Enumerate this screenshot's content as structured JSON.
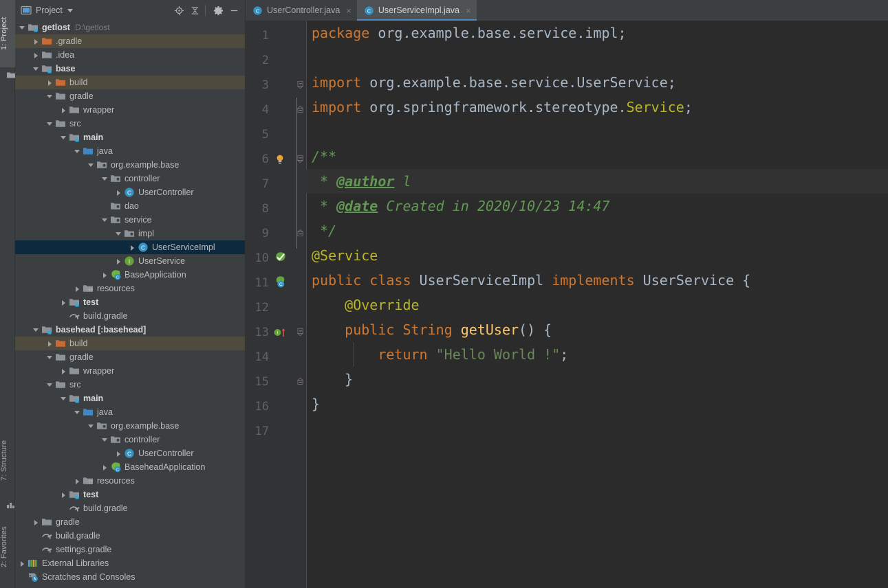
{
  "window": {
    "theme_bg": "#3c3f41",
    "editor_bg": "#2b2b2b",
    "accent": "#4a88c7",
    "selection": "#0d293e",
    "excluded_bg": "#4e4a3e"
  },
  "rail": {
    "items": [
      {
        "label": "1: Project",
        "icon": "project-icon",
        "active": true
      },
      {
        "label": "7: Structure",
        "icon": "structure-icon",
        "active": false
      },
      {
        "label": "2: Favorites",
        "icon": "favorites-icon",
        "active": false
      }
    ]
  },
  "project_panel": {
    "header": {
      "icon": "project-window-icon",
      "title": "Project",
      "caret": "chevron-down-icon",
      "buttons": [
        {
          "name": "locate-icon",
          "title": "Select Opened File"
        },
        {
          "name": "collapse-all-icon",
          "title": "Collapse All"
        },
        {
          "name": "gear-icon",
          "title": "Settings"
        },
        {
          "name": "minimize-icon",
          "title": "Hide"
        }
      ]
    },
    "tree": [
      {
        "indent": 0,
        "arrow": "down",
        "icon": "module-root-icon",
        "label": "getlost",
        "bold": true,
        "sub": "D:\\getlost",
        "state": "normal"
      },
      {
        "indent": 1,
        "arrow": "right",
        "icon": "folder-excluded-icon",
        "label": ".gradle",
        "bold": false,
        "sub": "",
        "state": "excluded"
      },
      {
        "indent": 1,
        "arrow": "right",
        "icon": "folder-icon",
        "label": ".idea",
        "bold": false,
        "sub": "",
        "state": "normal"
      },
      {
        "indent": 1,
        "arrow": "down",
        "icon": "module-root-icon",
        "label": "base",
        "bold": true,
        "sub": "",
        "state": "normal"
      },
      {
        "indent": 2,
        "arrow": "right",
        "icon": "folder-excluded-icon",
        "label": "build",
        "bold": false,
        "sub": "",
        "state": "excluded"
      },
      {
        "indent": 2,
        "arrow": "down",
        "icon": "folder-icon",
        "label": "gradle",
        "bold": false,
        "sub": "",
        "state": "normal"
      },
      {
        "indent": 3,
        "arrow": "right",
        "icon": "folder-icon",
        "label": "wrapper",
        "bold": false,
        "sub": "",
        "state": "normal"
      },
      {
        "indent": 2,
        "arrow": "down",
        "icon": "folder-icon",
        "label": "src",
        "bold": false,
        "sub": "",
        "state": "normal"
      },
      {
        "indent": 3,
        "arrow": "down",
        "icon": "module-root-icon",
        "label": "main",
        "bold": true,
        "sub": "",
        "state": "normal"
      },
      {
        "indent": 4,
        "arrow": "down",
        "icon": "source-root-icon",
        "label": "java",
        "bold": false,
        "sub": "",
        "state": "normal"
      },
      {
        "indent": 5,
        "arrow": "down",
        "icon": "package-icon",
        "label": "org.example.base",
        "bold": false,
        "sub": "",
        "state": "normal"
      },
      {
        "indent": 6,
        "arrow": "down",
        "icon": "package-icon",
        "label": "controller",
        "bold": false,
        "sub": "",
        "state": "normal"
      },
      {
        "indent": 7,
        "arrow": "right",
        "icon": "class-icon",
        "label": "UserController",
        "bold": false,
        "sub": "",
        "state": "normal"
      },
      {
        "indent": 6,
        "arrow": "none",
        "icon": "package-icon",
        "label": "dao",
        "bold": false,
        "sub": "",
        "state": "normal"
      },
      {
        "indent": 6,
        "arrow": "down",
        "icon": "package-icon",
        "label": "service",
        "bold": false,
        "sub": "",
        "state": "normal"
      },
      {
        "indent": 7,
        "arrow": "down",
        "icon": "package-icon",
        "label": "impl",
        "bold": false,
        "sub": "",
        "state": "normal"
      },
      {
        "indent": 8,
        "arrow": "right",
        "icon": "class-icon",
        "label": "UserServiceImpl",
        "bold": false,
        "sub": "",
        "state": "selected"
      },
      {
        "indent": 7,
        "arrow": "right",
        "icon": "interface-icon",
        "label": "UserService",
        "bold": false,
        "sub": "",
        "state": "normal"
      },
      {
        "indent": 6,
        "arrow": "right",
        "icon": "spring-class-icon",
        "label": "BaseApplication",
        "bold": false,
        "sub": "",
        "state": "normal"
      },
      {
        "indent": 4,
        "arrow": "right",
        "icon": "resources-root-icon",
        "label": "resources",
        "bold": false,
        "sub": "",
        "state": "normal"
      },
      {
        "indent": 3,
        "arrow": "right",
        "icon": "test-root-icon",
        "label": "test",
        "bold": true,
        "sub": "",
        "state": "normal"
      },
      {
        "indent": 3,
        "arrow": "none",
        "icon": "gradle-file-icon",
        "label": "build.gradle",
        "bold": false,
        "sub": "",
        "state": "normal"
      },
      {
        "indent": 1,
        "arrow": "down",
        "icon": "module-root-icon",
        "label": "basehead [:basehead]",
        "bold": true,
        "sub": "",
        "state": "normal"
      },
      {
        "indent": 2,
        "arrow": "right",
        "icon": "folder-excluded-icon",
        "label": "build",
        "bold": false,
        "sub": "",
        "state": "excluded"
      },
      {
        "indent": 2,
        "arrow": "down",
        "icon": "folder-icon",
        "label": "gradle",
        "bold": false,
        "sub": "",
        "state": "normal"
      },
      {
        "indent": 3,
        "arrow": "right",
        "icon": "folder-icon",
        "label": "wrapper",
        "bold": false,
        "sub": "",
        "state": "normal"
      },
      {
        "indent": 2,
        "arrow": "down",
        "icon": "folder-icon",
        "label": "src",
        "bold": false,
        "sub": "",
        "state": "normal"
      },
      {
        "indent": 3,
        "arrow": "down",
        "icon": "module-root-icon",
        "label": "main",
        "bold": true,
        "sub": "",
        "state": "normal"
      },
      {
        "indent": 4,
        "arrow": "down",
        "icon": "source-root-icon",
        "label": "java",
        "bold": false,
        "sub": "",
        "state": "normal"
      },
      {
        "indent": 5,
        "arrow": "down",
        "icon": "package-icon",
        "label": "org.example.base",
        "bold": false,
        "sub": "",
        "state": "normal"
      },
      {
        "indent": 6,
        "arrow": "down",
        "icon": "package-icon",
        "label": "controller",
        "bold": false,
        "sub": "",
        "state": "normal"
      },
      {
        "indent": 7,
        "arrow": "right",
        "icon": "class-icon",
        "label": "UserController",
        "bold": false,
        "sub": "",
        "state": "normal"
      },
      {
        "indent": 6,
        "arrow": "right",
        "icon": "spring-class-icon",
        "label": "BaseheadApplication",
        "bold": false,
        "sub": "",
        "state": "normal"
      },
      {
        "indent": 4,
        "arrow": "right",
        "icon": "resources-root-icon",
        "label": "resources",
        "bold": false,
        "sub": "",
        "state": "normal"
      },
      {
        "indent": 3,
        "arrow": "right",
        "icon": "test-root-icon",
        "label": "test",
        "bold": true,
        "sub": "",
        "state": "normal"
      },
      {
        "indent": 3,
        "arrow": "none",
        "icon": "gradle-file-icon",
        "label": "build.gradle",
        "bold": false,
        "sub": "",
        "state": "normal"
      },
      {
        "indent": 1,
        "arrow": "right",
        "icon": "folder-icon",
        "label": "gradle",
        "bold": false,
        "sub": "",
        "state": "normal"
      },
      {
        "indent": 1,
        "arrow": "none",
        "icon": "gradle-file-icon",
        "label": "build.gradle",
        "bold": false,
        "sub": "",
        "state": "normal"
      },
      {
        "indent": 1,
        "arrow": "none",
        "icon": "gradle-file-icon",
        "label": "settings.gradle",
        "bold": false,
        "sub": "",
        "state": "normal"
      },
      {
        "indent": 0,
        "arrow": "right",
        "icon": "external-libraries-icon",
        "label": "External Libraries",
        "bold": false,
        "sub": "",
        "state": "normal"
      },
      {
        "indent": 0,
        "arrow": "none",
        "icon": "scratches-icon",
        "label": "Scratches and Consoles",
        "bold": false,
        "sub": "",
        "state": "normal"
      }
    ]
  },
  "editor": {
    "tabs": [
      {
        "label": "UserControllerjava",
        "display": "UserController.java",
        "icon": "java-class-icon",
        "active": false,
        "close": "×"
      },
      {
        "label": "UserServiceImpl.java",
        "display": "UserServiceImpl.java",
        "icon": "java-class-icon",
        "active": true,
        "close": "×"
      }
    ],
    "lines": [
      {
        "n": "1",
        "gutter_icon": "",
        "fold": "",
        "current": false,
        "tokens": [
          {
            "t": "package",
            "c": "kw"
          },
          {
            "t": " org.example.base.service.impl;",
            "c": "id"
          }
        ]
      },
      {
        "n": "2",
        "gutter_icon": "",
        "fold": "",
        "current": false,
        "tokens": []
      },
      {
        "n": "3",
        "gutter_icon": "",
        "fold": "top",
        "current": false,
        "tokens": [
          {
            "t": "import",
            "c": "kw"
          },
          {
            "t": " org.example.base.service.UserService;",
            "c": "id"
          }
        ]
      },
      {
        "n": "4",
        "gutter_icon": "",
        "fold": "bottom",
        "current": false,
        "tokens": [
          {
            "t": "import",
            "c": "kw"
          },
          {
            "t": " org.springframework.stereotype.",
            "c": "id"
          },
          {
            "t": "Service",
            "c": "ann"
          },
          {
            "t": ";",
            "c": "id"
          }
        ]
      },
      {
        "n": "5",
        "gutter_icon": "",
        "fold": "",
        "current": false,
        "tokens": []
      },
      {
        "n": "6",
        "gutter_icon": "lightbulb-icon",
        "fold": "top",
        "current": false,
        "tokens": [
          {
            "t": "/**",
            "c": "cmt"
          }
        ]
      },
      {
        "n": "7",
        "gutter_icon": "",
        "fold": "",
        "current": true,
        "tokens": [
          {
            "t": " * ",
            "c": "cmt"
          },
          {
            "t": "@author",
            "c": "cmt-tag"
          },
          {
            "t": " l",
            "c": "cmt"
          }
        ]
      },
      {
        "n": "8",
        "gutter_icon": "",
        "fold": "",
        "current": false,
        "tokens": [
          {
            "t": " * ",
            "c": "cmt"
          },
          {
            "t": "@date",
            "c": "cmt-tag"
          },
          {
            "t": " Created in 2020/10/23 14:47",
            "c": "cmt"
          }
        ]
      },
      {
        "n": "9",
        "gutter_icon": "",
        "fold": "bottom",
        "current": false,
        "tokens": [
          {
            "t": " */",
            "c": "cmt"
          }
        ]
      },
      {
        "n": "10",
        "gutter_icon": "spring-bean-check-icon",
        "fold": "",
        "current": false,
        "tokens": [
          {
            "t": "@Service",
            "c": "ann"
          }
        ]
      },
      {
        "n": "11",
        "gutter_icon": "spring-bean-class-icon",
        "fold": "",
        "current": false,
        "tokens": [
          {
            "t": "public class",
            "c": "kw"
          },
          {
            "t": " UserServiceImpl ",
            "c": "id"
          },
          {
            "t": "implements",
            "c": "kw"
          },
          {
            "t": " UserService {",
            "c": "id"
          }
        ]
      },
      {
        "n": "12",
        "gutter_icon": "",
        "fold": "",
        "current": false,
        "tokens": [
          {
            "t": "    @Override",
            "c": "ann"
          }
        ]
      },
      {
        "n": "13",
        "gutter_icon": "implementing-method-icon",
        "fold": "top",
        "current": false,
        "tokens": [
          {
            "t": "    public String ",
            "c": "kw"
          },
          {
            "t": "getUser",
            "c": "mth"
          },
          {
            "t": "() {",
            "c": "id"
          }
        ]
      },
      {
        "n": "14",
        "gutter_icon": "",
        "fold": "",
        "current": false,
        "tokens": [
          {
            "t": "        return ",
            "c": "kw"
          },
          {
            "t": "\"Hello World !\"",
            "c": "str"
          },
          {
            "t": ";",
            "c": "id"
          }
        ]
      },
      {
        "n": "15",
        "gutter_icon": "",
        "fold": "bottom",
        "current": false,
        "tokens": [
          {
            "t": "    }",
            "c": "id"
          }
        ]
      },
      {
        "n": "16",
        "gutter_icon": "",
        "fold": "",
        "current": false,
        "tokens": [
          {
            "t": "}",
            "c": "id"
          }
        ]
      },
      {
        "n": "17",
        "gutter_icon": "",
        "fold": "",
        "current": false,
        "tokens": []
      }
    ]
  }
}
